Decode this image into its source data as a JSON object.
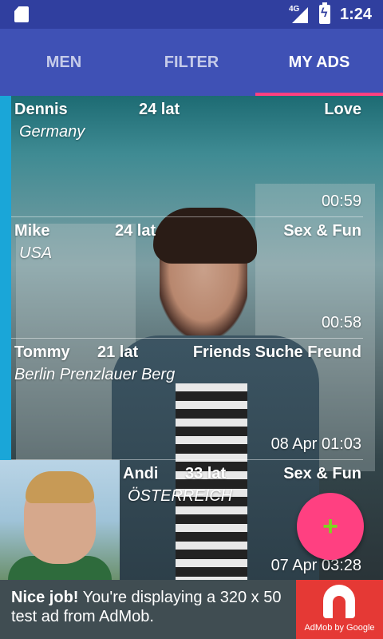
{
  "status_bar": {
    "network": "4G",
    "time": "1:24"
  },
  "tabs": [
    {
      "label": "MEN",
      "active": false
    },
    {
      "label": "FILTER",
      "active": false
    },
    {
      "label": "MY ADS",
      "active": true
    }
  ],
  "ads": [
    {
      "name": "Dennis",
      "age": "24 lat",
      "category": "Love",
      "location": "Germany",
      "time": "00:59"
    },
    {
      "name": "Mike",
      "age": "24 lat",
      "category": "Sex & Fun",
      "location": "USA",
      "time": "00:58"
    },
    {
      "name": "Tommy",
      "age": "21 lat",
      "category": "Friends Suche Freund",
      "location": "Berlin Prenzlauer Berg",
      "time": "08 Apr 01:03"
    },
    {
      "name": "Andi",
      "age": "33 lat",
      "category": "Sex & Fun",
      "location": "ÖSTERREICH",
      "time": "07 Apr 03:28"
    }
  ],
  "fab": {
    "icon": "plus-icon",
    "label": "+"
  },
  "ad_banner": {
    "bold": "Nice job!",
    "text": " You're displaying a 320 x 50 test ad from AdMob.",
    "logo_label": "AdMob by Google"
  },
  "colors": {
    "primary": "#3f51b5",
    "primary_dark": "#303f9f",
    "accent": "#ff4081",
    "row_accent": "#1aa6d8"
  }
}
